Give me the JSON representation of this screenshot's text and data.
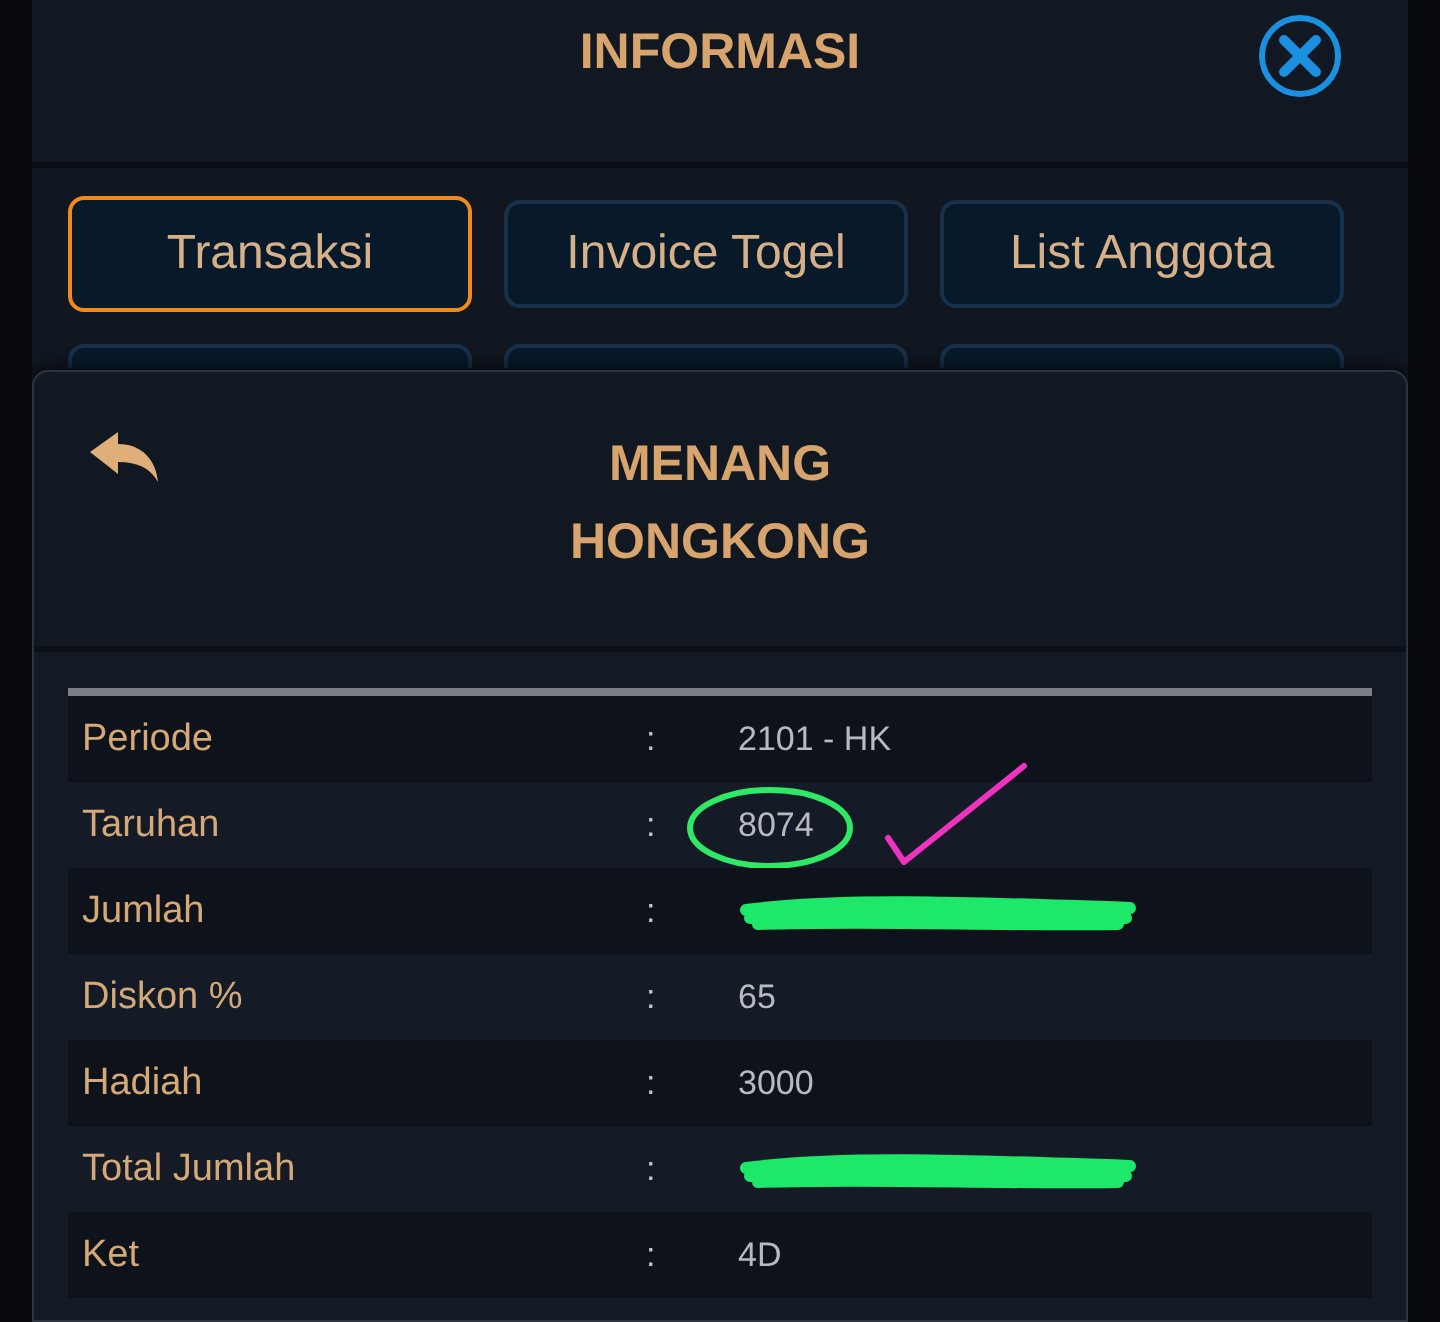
{
  "header": {
    "title": "INFORMASI"
  },
  "tabs": [
    {
      "label": "Transaksi",
      "selected": true
    },
    {
      "label": "Invoice Togel",
      "selected": false
    },
    {
      "label": "List Anggota",
      "selected": false
    }
  ],
  "detail": {
    "title": "MENANG",
    "subtitle": "HONGKONG",
    "rows": [
      {
        "label": "Periode",
        "separator": ":",
        "value": "2101 - HK",
        "redacted": false,
        "circled": false,
        "ticked": false
      },
      {
        "label": "Taruhan",
        "separator": ":",
        "value": "8074",
        "redacted": false,
        "circled": true,
        "ticked": true
      },
      {
        "label": "Jumlah",
        "separator": ":",
        "redacted": true,
        "circled": false,
        "ticked": false
      },
      {
        "label": "Diskon %",
        "separator": ":",
        "value": "65",
        "redacted": false,
        "circled": false,
        "ticked": false
      },
      {
        "label": "Hadiah",
        "separator": ":",
        "value": "3000",
        "redacted": false,
        "circled": false,
        "ticked": false
      },
      {
        "label": "Total Jumlah",
        "separator": ":",
        "redacted": true,
        "circled": false,
        "ticked": false
      },
      {
        "label": "Ket",
        "separator": ":",
        "value": "4D",
        "redacted": false,
        "circled": false,
        "ticked": false
      }
    ]
  }
}
